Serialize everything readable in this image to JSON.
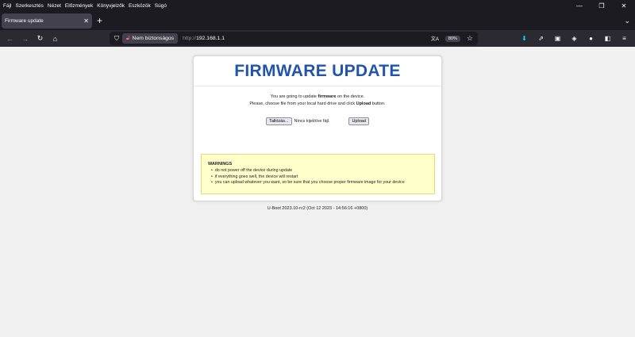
{
  "menubar": {
    "items": [
      "Fájl",
      "Szerkesztés",
      "Nézet",
      "Előzmények",
      "Könyvjelzők",
      "Eszközök",
      "Súgó"
    ]
  },
  "window_controls": {
    "minimize": "—",
    "restore": "❐",
    "close": "✕"
  },
  "tabs": [
    {
      "title": "Firmware update",
      "close": "✕"
    }
  ],
  "tabbar": {
    "new_tab": "+",
    "list_tabs": "⌄"
  },
  "nav": {
    "back": "←",
    "forward": "→",
    "reload": "↻",
    "home": "⌂",
    "security_label": "Nem biztonságos",
    "url_protocol": "http://",
    "url_host": "192.168.1.1",
    "zoom": "80%",
    "translate": "文A",
    "bookmark": "☆"
  },
  "toolbar": {
    "download": "⬇",
    "extensions_1": "⇗",
    "extensions_2": "▣",
    "extensions_3": "◈",
    "extensions_4": "●",
    "extensions_5": "◧",
    "menu": "≡"
  },
  "page": {
    "title": "FIRMWARE UPDATE",
    "intro_line1_pre": "You are going to update ",
    "intro_line1_bold": "firmware",
    "intro_line1_post": " on the device.",
    "intro_line2_pre": "Please, choose file from your local hard drive and click ",
    "intro_line2_bold": "Upload",
    "intro_line2_post": " button.",
    "browse_button": "Tallózás...",
    "file_status": "Nincs kijelölve fájl.",
    "upload_button": "Upload",
    "warnings_title": "WARNINGS",
    "warnings": [
      "do not power off the device during update",
      "if everything goes well, the device will restart",
      "you can upload whatever you want, so be sure that you choose proper firmware image for your device"
    ],
    "footer": "U-Boot 2023.10-rc2 (Oct 12 2023 - 14:56:16 +0800)"
  },
  "colors": {
    "title": "#2255aa",
    "warning_bg": "#ffffcc",
    "chrome_dark": "#1c1b22"
  }
}
